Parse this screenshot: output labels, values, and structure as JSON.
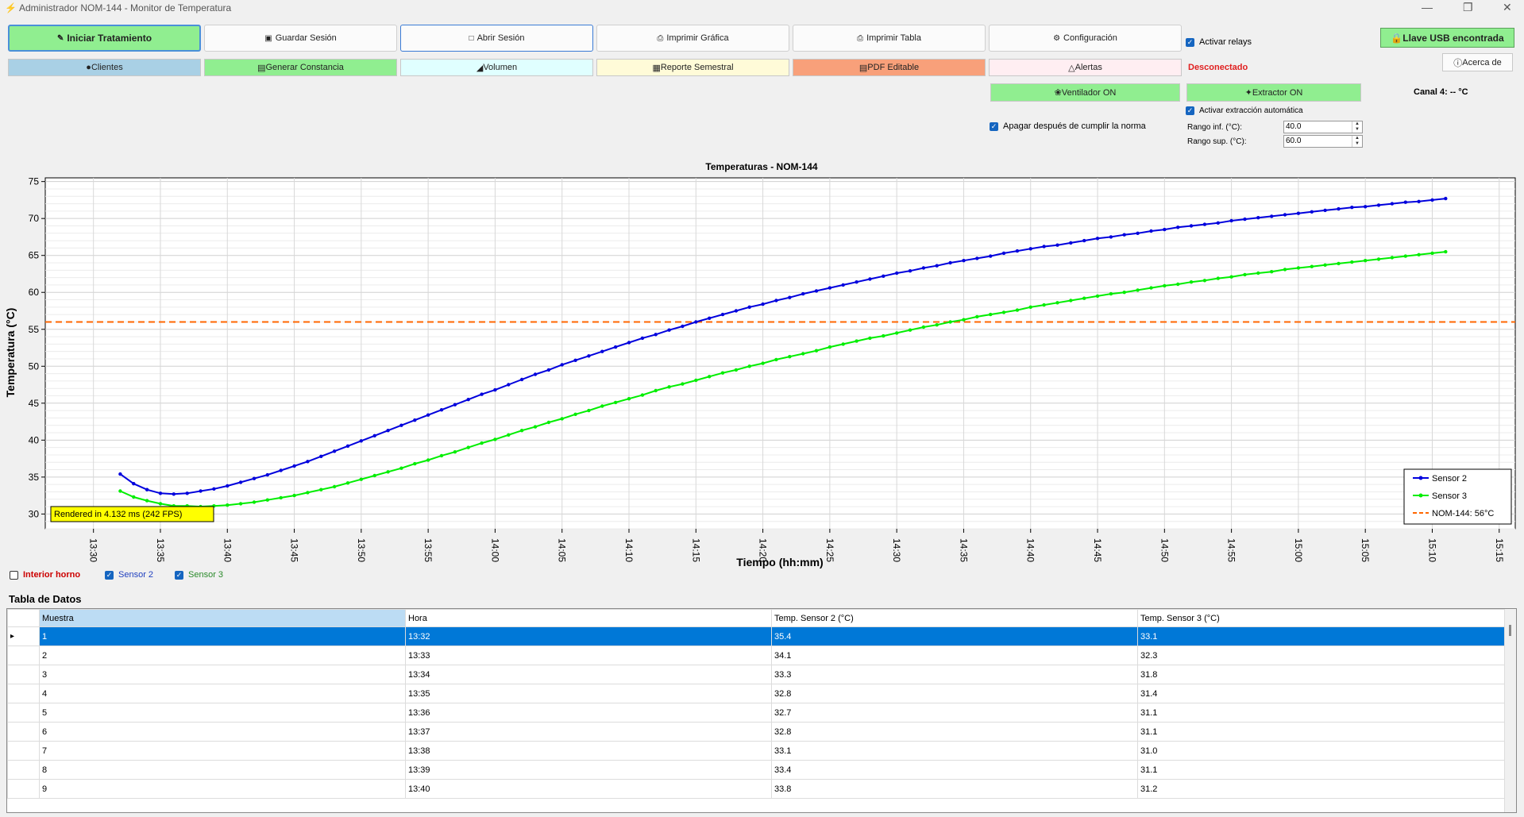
{
  "window": {
    "title": "Administrador NOM-144 - Monitor de Temperatura"
  },
  "toolbar": {
    "row1": [
      "Iniciar Tratamiento",
      "Guardar Sesión",
      "Abrir Sesión",
      "Imprimir Gráfica",
      "Imprimir Tabla",
      "Configuración"
    ],
    "row2": [
      "Clientes",
      "Generar Constancia",
      "Volumen",
      "Reporte Semestral",
      "PDF Editable",
      "Alertas"
    ],
    "activar_relays": "Activar relays",
    "usb_status": "Llave USB encontrada",
    "acerca": "Acerca de",
    "connection_status": "Desconectado",
    "ventilador": "Ventilador ON",
    "extractor": "Extractor ON",
    "canal4": "Canal 4: -- °C",
    "auto_extract": "Activar extracción automática",
    "apagar": "Apagar después de cumplir la norma",
    "rango_inf_label": "Rango inf. (°C):",
    "rango_inf_value": "40.0",
    "rango_sup_label": "Rango sup. (°C):",
    "rango_sup_value": "60.0"
  },
  "colors": {
    "sensor2": "#0000dd",
    "sensor3": "#00ee00",
    "threshold": "#ff6600",
    "start_button": "#90ee90",
    "selection": "#0078d7"
  },
  "chart_data": {
    "type": "line",
    "title": "Temperaturas - NOM-144",
    "xlabel": "Tiempo (hh:mm)",
    "ylabel": "Temperatura (°C)",
    "xlim": [
      "13:30",
      "15:15"
    ],
    "ylim": [
      28,
      75.5
    ],
    "x_ticks": [
      "13:30",
      "13:35",
      "13:40",
      "13:45",
      "13:50",
      "13:55",
      "14:00",
      "14:05",
      "14:10",
      "14:15",
      "14:20",
      "14:25",
      "14:30",
      "14:35",
      "14:40",
      "14:45",
      "14:50",
      "14:55",
      "15:00",
      "15:05",
      "15:10",
      "15:15"
    ],
    "y_ticks": [
      30,
      35,
      40,
      45,
      50,
      55,
      60,
      65,
      70,
      75
    ],
    "x_start": "13:32",
    "x_end": "15:11",
    "series": [
      {
        "name": "Sensor 2",
        "values": [
          35.4,
          34.1,
          33.3,
          32.8,
          32.7,
          32.8,
          33.1,
          33.4,
          33.8,
          34.3,
          34.8,
          35.3,
          35.9,
          36.5,
          37.1,
          37.8,
          38.5,
          39.2,
          39.9,
          40.6,
          41.3,
          42.0,
          42.7,
          43.4,
          44.1,
          44.8,
          45.5,
          46.2,
          46.8,
          47.5,
          48.2,
          48.9,
          49.5,
          50.2,
          50.8,
          51.4,
          52.0,
          52.6,
          53.2,
          53.8,
          54.3,
          54.9,
          55.4,
          56.0,
          56.5,
          57.0,
          57.5,
          58.0,
          58.4,
          58.9,
          59.3,
          59.8,
          60.2,
          60.6,
          61.0,
          61.4,
          61.8,
          62.2,
          62.6,
          62.9,
          63.3,
          63.6,
          64.0,
          64.3,
          64.6,
          64.9,
          65.3,
          65.6,
          65.9,
          66.2,
          66.4,
          66.7,
          67.0,
          67.3,
          67.5,
          67.8,
          68.0,
          68.3,
          68.5,
          68.8,
          69.0,
          69.2,
          69.4,
          69.7,
          69.9,
          70.1,
          70.3,
          70.5,
          70.7,
          70.9,
          71.1,
          71.3,
          71.5,
          71.6,
          71.8,
          72.0,
          72.2,
          72.3,
          72.5,
          72.7
        ]
      },
      {
        "name": "Sensor 3",
        "values": [
          33.1,
          32.3,
          31.8,
          31.4,
          31.1,
          31.1,
          31.0,
          31.1,
          31.2,
          31.4,
          31.6,
          31.9,
          32.2,
          32.5,
          32.9,
          33.3,
          33.7,
          34.2,
          34.7,
          35.2,
          35.7,
          36.2,
          36.8,
          37.3,
          37.9,
          38.4,
          39.0,
          39.6,
          40.1,
          40.7,
          41.3,
          41.8,
          42.4,
          42.9,
          43.5,
          44.0,
          44.6,
          45.1,
          45.6,
          46.1,
          46.7,
          47.2,
          47.6,
          48.1,
          48.6,
          49.1,
          49.5,
          50.0,
          50.4,
          50.9,
          51.3,
          51.7,
          52.1,
          52.6,
          53.0,
          53.4,
          53.8,
          54.1,
          54.5,
          54.9,
          55.3,
          55.6,
          56.0,
          56.3,
          56.7,
          57.0,
          57.3,
          57.6,
          58.0,
          58.3,
          58.6,
          58.9,
          59.2,
          59.5,
          59.8,
          60.0,
          60.3,
          60.6,
          60.9,
          61.1,
          61.4,
          61.6,
          61.9,
          62.1,
          62.4,
          62.6,
          62.8,
          63.1,
          63.3,
          63.5,
          63.7,
          63.9,
          64.1,
          64.3,
          64.5,
          64.7,
          64.9,
          65.1,
          65.3,
          65.5
        ]
      }
    ],
    "threshold": {
      "name": "NOM-144: 56°C",
      "value": 56
    },
    "legend": "bottom-right",
    "grid": true,
    "annotation": "Rendered in 4.132 ms (242 FPS)"
  },
  "series_toggles": [
    {
      "label": "Interior horno",
      "checked": false,
      "color": "#cc0000"
    },
    {
      "label": "Sensor 2",
      "checked": true,
      "color": "#1f3fbf"
    },
    {
      "label": "Sensor 3",
      "checked": true,
      "color": "#2a8a2a"
    }
  ],
  "table": {
    "title": "Tabla de Datos",
    "columns": [
      "Muestra",
      "Hora",
      "Temp. Sensor 2 (°C)",
      "Temp. Sensor 3 (°C)"
    ],
    "rows": [
      [
        "1",
        "13:32",
        "35.4",
        "33.1"
      ],
      [
        "2",
        "13:33",
        "34.1",
        "32.3"
      ],
      [
        "3",
        "13:34",
        "33.3",
        "31.8"
      ],
      [
        "4",
        "13:35",
        "32.8",
        "31.4"
      ],
      [
        "5",
        "13:36",
        "32.7",
        "31.1"
      ],
      [
        "6",
        "13:37",
        "32.8",
        "31.1"
      ],
      [
        "7",
        "13:38",
        "33.1",
        "31.0"
      ],
      [
        "8",
        "13:39",
        "33.4",
        "31.1"
      ],
      [
        "9",
        "13:40",
        "33.8",
        "31.2"
      ]
    ],
    "selected_row": 0
  }
}
